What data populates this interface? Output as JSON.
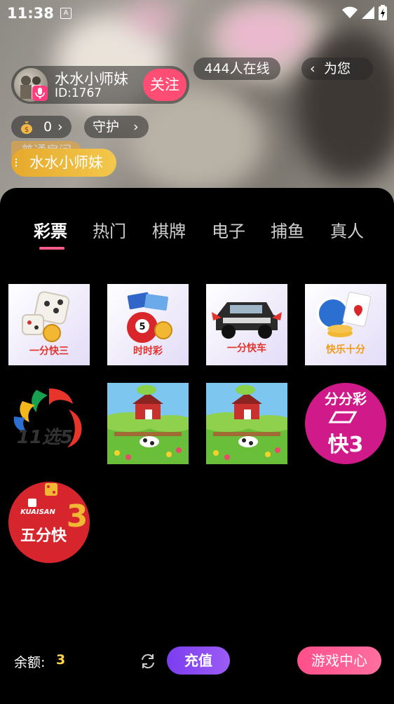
{
  "status_bar": {
    "time": "11:38",
    "sim_label": "A"
  },
  "anchor": {
    "name": "水水小师妹",
    "id": "ID:1767",
    "follow_label": "关注"
  },
  "room": {
    "online": "444人在线",
    "for_you": "为您"
  },
  "coins": {
    "value": "0"
  },
  "guard": {
    "label": "守护"
  },
  "welcome": {
    "badge": "普通房间",
    "entry_name": "水水小师妹"
  },
  "tabs": [
    {
      "label": "彩票",
      "active": true
    },
    {
      "label": "热门",
      "active": false
    },
    {
      "label": "棋牌",
      "active": false
    },
    {
      "label": "电子",
      "active": false
    },
    {
      "label": "捕鱼",
      "active": false
    },
    {
      "label": "真人",
      "active": false
    }
  ],
  "games": [
    {
      "icon": "dice-icon",
      "caption": "一分快三"
    },
    {
      "icon": "lottery-ball-icon",
      "caption": "时时彩"
    },
    {
      "icon": "jeep-icon",
      "caption": "一分快车"
    },
    {
      "icon": "poker-chips-icon",
      "caption": "快乐十分"
    },
    {
      "icon": "eleven-choose-five-logo",
      "caption": "11选5"
    },
    {
      "icon": "farm-icon",
      "caption": ""
    },
    {
      "icon": "farm-icon",
      "caption": ""
    },
    {
      "icon": "kuai3-logo",
      "caption": "分分彩",
      "caption2": "快3"
    },
    {
      "icon": "kuaisan-logo",
      "caption": "五分快",
      "caption2": "KUAISAN"
    }
  ],
  "bottom": {
    "balance_label": "余额:",
    "balance_value": "3",
    "recharge_label": "充值",
    "game_center_label": "游戏中心"
  },
  "colors": {
    "accent_pink": "#ff4d73",
    "accent_purple": "#7b3df0",
    "balance_yellow": "#ffd54f"
  }
}
